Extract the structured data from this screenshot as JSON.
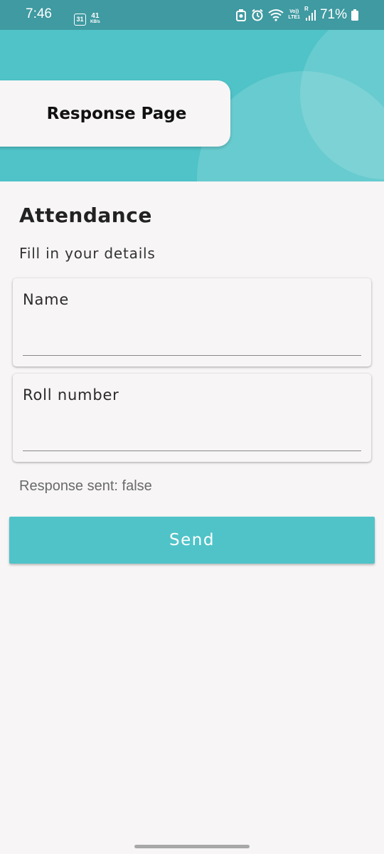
{
  "status_bar": {
    "time": "7:46",
    "calendar_day": "31",
    "net_speed_value": "41",
    "net_speed_unit": "KB/s",
    "volte_top": "Vo))",
    "volte_bottom": "LTE1",
    "roaming": "R",
    "battery_percent": "71%"
  },
  "header": {
    "title": "Response Page"
  },
  "form": {
    "heading": "Attendance",
    "subheading": "Fill in your details",
    "fields": [
      {
        "label": "Name",
        "value": ""
      },
      {
        "label": "Roll number",
        "value": ""
      }
    ],
    "response_status": "Response sent: false",
    "send_label": "Send"
  },
  "colors": {
    "accent": "#4fc3c8",
    "status_bar": "#3f9aa1",
    "background": "#f7f5f6"
  }
}
